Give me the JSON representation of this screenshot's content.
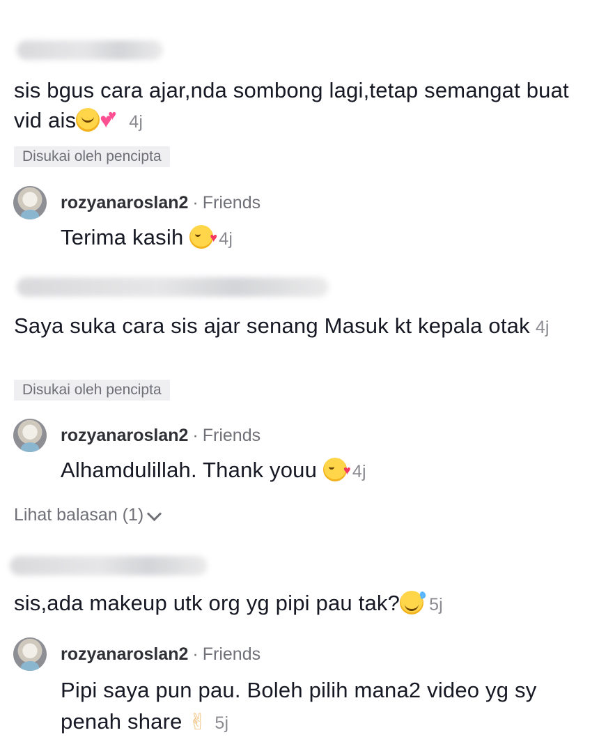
{
  "comments": [
    {
      "text": "sis bgus cara ajar,nda sombong lagi,tetap semangat buat vid ais",
      "time": "4j",
      "liked_label": "Disukai oleh pencipta",
      "reply": {
        "user": "rozyanaroslan2",
        "tag": "Friends",
        "text": "Terima kasih",
        "time": "4j"
      }
    },
    {
      "text": "Saya suka cara sis ajar senang Masuk kt kepala otak",
      "time": "4j",
      "liked_label": "Disukai oleh pencipta",
      "reply": {
        "user": "rozyanaroslan2",
        "tag": "Friends",
        "text": "Alhamdulillah. Thank youu",
        "time": "4j"
      },
      "view_replies": "Lihat balasan (1)"
    },
    {
      "text": "sis,ada makeup utk org yg pipi pau tak?",
      "time": "5j",
      "reply": {
        "user": "rozyanaroslan2",
        "tag": "Friends",
        "text": "Pipi saya pun pau. Boleh pilih mana2 video yg sy penah share",
        "time": "5j"
      }
    }
  ],
  "separator_dot": "·"
}
